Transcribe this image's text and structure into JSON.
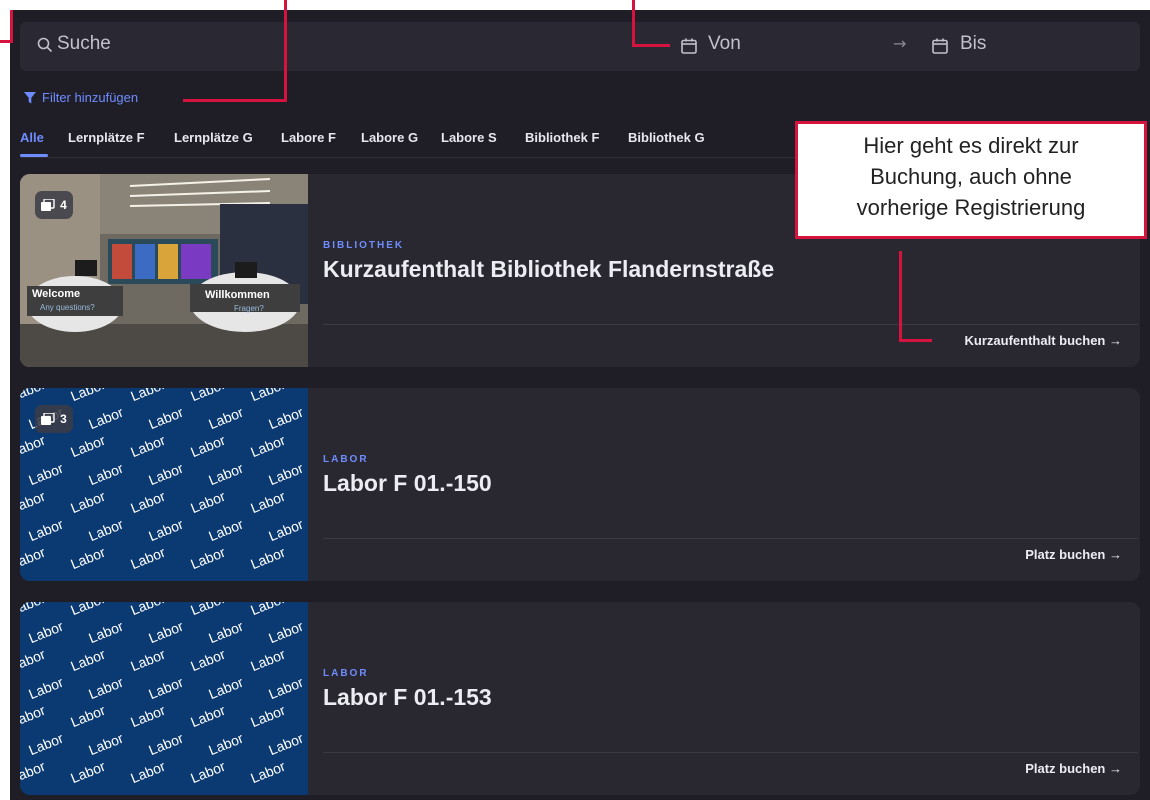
{
  "search": {
    "placeholder": "Suche"
  },
  "dates": {
    "from": "Von",
    "to": "Bis"
  },
  "filter": {
    "label": "Filter hinzufügen"
  },
  "tabs": [
    "Alle",
    "Lernplätze F",
    "Lernplätze G",
    "Labore F",
    "Labore G",
    "Labore S",
    "Bibliothek F",
    "Bibliothek G"
  ],
  "cards": [
    {
      "category": "BIBLIOTHEK",
      "title": "Kurzaufenthalt Bibliothek Flandernstraße",
      "action": "Kurzaufenthalt buchen",
      "image_count": "4",
      "image_signs": [
        "Welcome",
        "Any questions?",
        "Willkommen",
        "Fragen?"
      ]
    },
    {
      "category": "LABOR",
      "title": "Labor F 01.-150",
      "action": "Platz buchen",
      "image_count": "3",
      "image_text": "Labor"
    },
    {
      "category": "LABOR",
      "title": "Labor F 01.-153",
      "action": "Platz buchen",
      "image_text": "Labor"
    }
  ],
  "annotation": {
    "lines": [
      "Hier geht es direkt zur",
      "Buchung, auch ohne",
      "vorherige Registrierung"
    ]
  },
  "colors": {
    "accent": "#6f8cff",
    "background": "#1f1e27",
    "card": "#292831",
    "annotation_red": "#d6123f",
    "labor_blue": "#0b3a73"
  },
  "icons": {
    "search": "search-icon",
    "calendar": "calendar-icon",
    "filter": "filter-icon",
    "arrow": "arrow-right-icon",
    "gallery": "gallery-icon"
  }
}
